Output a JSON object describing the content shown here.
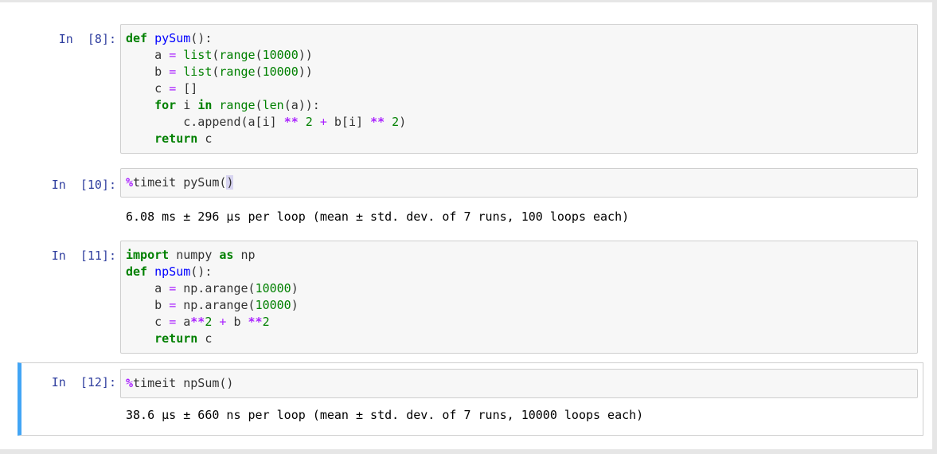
{
  "cells": [
    {
      "prompt": "In  [8]:",
      "lines": [
        [
          [
            "kw",
            "def"
          ],
          [
            "id",
            " "
          ],
          [
            "fn",
            "pySum"
          ],
          [
            "paren",
            "():"
          ]
        ],
        [
          [
            "id",
            "    a "
          ],
          [
            "opl",
            "="
          ],
          [
            "id",
            " "
          ],
          [
            "bi",
            "list"
          ],
          [
            "paren",
            "("
          ],
          [
            "bi",
            "range"
          ],
          [
            "paren",
            "("
          ],
          [
            "num",
            "10000"
          ],
          [
            "paren",
            "))"
          ]
        ],
        [
          [
            "id",
            "    b "
          ],
          [
            "opl",
            "="
          ],
          [
            "id",
            " "
          ],
          [
            "bi",
            "list"
          ],
          [
            "paren",
            "("
          ],
          [
            "bi",
            "range"
          ],
          [
            "paren",
            "("
          ],
          [
            "num",
            "10000"
          ],
          [
            "paren",
            "))"
          ]
        ],
        [
          [
            "id",
            "    c "
          ],
          [
            "opl",
            "="
          ],
          [
            "id",
            " []"
          ]
        ],
        [
          [
            "id",
            "    "
          ],
          [
            "kw",
            "for"
          ],
          [
            "id",
            " i "
          ],
          [
            "kw",
            "in"
          ],
          [
            "id",
            " "
          ],
          [
            "bi",
            "range"
          ],
          [
            "paren",
            "("
          ],
          [
            "bi",
            "len"
          ],
          [
            "paren",
            "(a)):"
          ]
        ],
        [
          [
            "id",
            "        c.append(a[i] "
          ],
          [
            "op",
            "**"
          ],
          [
            "id",
            " "
          ],
          [
            "num",
            "2"
          ],
          [
            "id",
            " "
          ],
          [
            "opl",
            "+"
          ],
          [
            "id",
            " b[i] "
          ],
          [
            "op",
            "**"
          ],
          [
            "id",
            " "
          ],
          [
            "num",
            "2"
          ],
          [
            "paren",
            ")"
          ]
        ],
        [
          [
            "id",
            "    "
          ],
          [
            "kw",
            "return"
          ],
          [
            "id",
            " c"
          ]
        ]
      ],
      "output": ""
    },
    {
      "prompt": "In  [10]:",
      "lines": [
        [
          [
            "mag",
            "%"
          ],
          [
            "id",
            "timeit pySum"
          ],
          [
            "paren",
            "("
          ],
          [
            "hl",
            ")"
          ]
        ]
      ],
      "output": "6.08 ms ± 296 µs per loop (mean ± std. dev. of 7 runs, 100 loops each)"
    },
    {
      "prompt": "In  [11]:",
      "lines": [
        [
          [
            "kw",
            "import"
          ],
          [
            "id",
            " numpy "
          ],
          [
            "kw",
            "as"
          ],
          [
            "id",
            " np"
          ]
        ],
        [
          [
            "kw",
            "def"
          ],
          [
            "id",
            " "
          ],
          [
            "fn",
            "npSum"
          ],
          [
            "paren",
            "():"
          ]
        ],
        [
          [
            "id",
            "    a "
          ],
          [
            "opl",
            "="
          ],
          [
            "id",
            " np.arange("
          ],
          [
            "num",
            "10000"
          ],
          [
            "paren",
            ")"
          ]
        ],
        [
          [
            "id",
            "    b "
          ],
          [
            "opl",
            "="
          ],
          [
            "id",
            " np.arange("
          ],
          [
            "num",
            "10000"
          ],
          [
            "paren",
            ")"
          ]
        ],
        [
          [
            "id",
            "    c "
          ],
          [
            "opl",
            "="
          ],
          [
            "id",
            " a"
          ],
          [
            "op",
            "**"
          ],
          [
            "num",
            "2"
          ],
          [
            "id",
            " "
          ],
          [
            "opl",
            "+"
          ],
          [
            "id",
            " b "
          ],
          [
            "op",
            "**"
          ],
          [
            "num",
            "2"
          ]
        ],
        [
          [
            "id",
            "    "
          ],
          [
            "kw",
            "return"
          ],
          [
            "id",
            " c"
          ]
        ]
      ],
      "output": ""
    },
    {
      "prompt": "In  [12]:",
      "lines": [
        [
          [
            "mag",
            "%"
          ],
          [
            "id",
            "timeit npSum()"
          ]
        ]
      ],
      "output": "38.6 µs ± 660 ns per loop (mean ± std. dev. of 7 runs, 10000 loops each)"
    }
  ],
  "colors": {
    "prompt": "#303f9f",
    "keyword": "#008000",
    "function_name": "#0000ff",
    "operator": "#aa22ff",
    "selected_cell_bar": "#42a5f5",
    "input_background": "#f7f7f7"
  }
}
